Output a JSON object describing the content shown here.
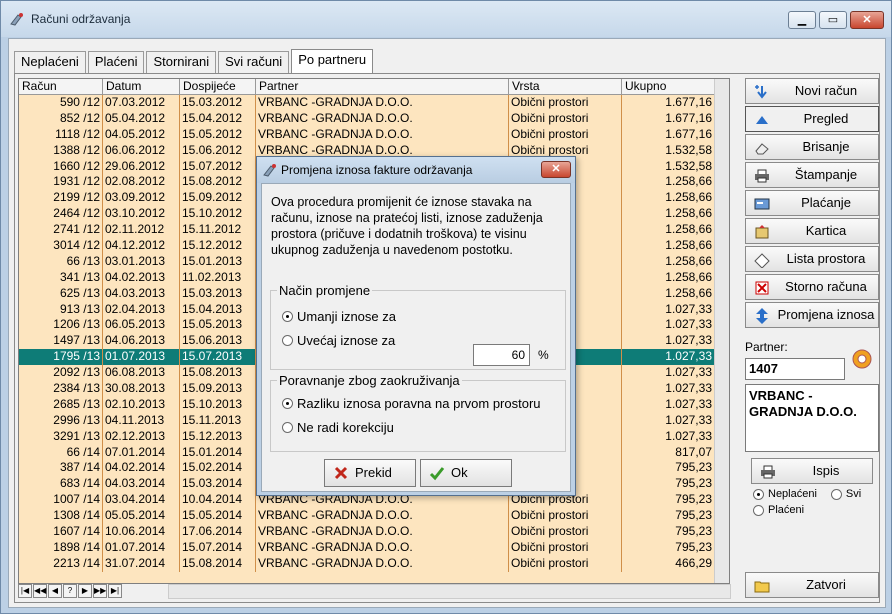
{
  "window": {
    "title": "Računi održavanja"
  },
  "tabs": [
    "Neplaćeni",
    "Plaćeni",
    "Stornirani",
    "Svi računi",
    "Po partneru"
  ],
  "grid": {
    "columns": [
      "Račun",
      "Datum",
      "Dospijeće",
      "Partner",
      "Vrsta",
      "Ukupno"
    ],
    "rows": [
      [
        "590 /12",
        "07.03.2012",
        "15.03.2012",
        "VRBANC -GRADNJA D.O.O.",
        "Obični prostori",
        "1.677,16"
      ],
      [
        "852 /12",
        "05.04.2012",
        "15.04.2012",
        "VRBANC -GRADNJA D.O.O.",
        "Obični prostori",
        "1.677,16"
      ],
      [
        "1118 /12",
        "04.05.2012",
        "15.05.2012",
        "VRBANC -GRADNJA D.O.O.",
        "Obični prostori",
        "1.677,16"
      ],
      [
        "1388 /12",
        "06.06.2012",
        "15.06.2012",
        "VRBANC -GRADNJA D.O.O.",
        "Obični prostori",
        "1.532,58"
      ],
      [
        "1660 /12",
        "29.06.2012",
        "15.07.2012",
        "",
        "prostori",
        "1.532,58"
      ],
      [
        "1931 /12",
        "02.08.2012",
        "15.08.2012",
        "",
        "prostori",
        "1.258,66"
      ],
      [
        "2199 /12",
        "03.09.2012",
        "15.09.2012",
        "",
        "prostori",
        "1.258,66"
      ],
      [
        "2464 /12",
        "03.10.2012",
        "15.10.2012",
        "",
        "prostori",
        "1.258,66"
      ],
      [
        "2741 /12",
        "02.11.2012",
        "15.11.2012",
        "",
        "prostori",
        "1.258,66"
      ],
      [
        "3014 /12",
        "04.12.2012",
        "15.12.2012",
        "",
        "prostori",
        "1.258,66"
      ],
      [
        "66 /13",
        "03.01.2013",
        "15.01.2013",
        "",
        "prostori",
        "1.258,66"
      ],
      [
        "341 /13",
        "04.02.2013",
        "11.02.2013",
        "",
        "prostori",
        "1.258,66"
      ],
      [
        "625 /13",
        "04.03.2013",
        "15.03.2013",
        "",
        "prostori",
        "1.258,66"
      ],
      [
        "913 /13",
        "02.04.2013",
        "15.04.2013",
        "",
        "prostori",
        "1.027,33"
      ],
      [
        "1206 /13",
        "06.05.2013",
        "15.05.2013",
        "",
        "prostori",
        "1.027,33"
      ],
      [
        "1497 /13",
        "04.06.2013",
        "15.06.2013",
        "",
        "prostori",
        "1.027,33"
      ],
      [
        "1795 /13",
        "01.07.2013",
        "15.07.2013",
        "",
        "prostori",
        "1.027,33"
      ],
      [
        "2092 /13",
        "06.08.2013",
        "15.08.2013",
        "",
        "prostori",
        "1.027,33"
      ],
      [
        "2384 /13",
        "30.08.2013",
        "15.09.2013",
        "",
        "prostori",
        "1.027,33"
      ],
      [
        "2685 /13",
        "02.10.2013",
        "15.10.2013",
        "",
        "prostori",
        "1.027,33"
      ],
      [
        "2996 /13",
        "04.11.2013",
        "15.11.2013",
        "",
        "prostori",
        "1.027,33"
      ],
      [
        "3291 /13",
        "02.12.2013",
        "15.12.2013",
        "",
        "prostori",
        "1.027,33"
      ],
      [
        "66 /14",
        "07.01.2014",
        "15.01.2014",
        "",
        "prostori",
        "817,07"
      ],
      [
        "387 /14",
        "04.02.2014",
        "15.02.2014",
        "",
        "prostori",
        "795,23"
      ],
      [
        "683 /14",
        "04.03.2014",
        "15.03.2014",
        "",
        "prostori",
        "795,23"
      ],
      [
        "1007 /14",
        "03.04.2014",
        "10.04.2014",
        "VRBANC -GRADNJA D.O.O.",
        "Obični prostori",
        "795,23"
      ],
      [
        "1308 /14",
        "05.05.2014",
        "15.05.2014",
        "VRBANC -GRADNJA D.O.O.",
        "Obični prostori",
        "795,23"
      ],
      [
        "1607 /14",
        "10.06.2014",
        "17.06.2014",
        "VRBANC -GRADNJA D.O.O.",
        "Obični prostori",
        "795,23"
      ],
      [
        "1898 /14",
        "01.07.2014",
        "15.07.2014",
        "VRBANC -GRADNJA D.O.O.",
        "Obični prostori",
        "795,23"
      ],
      [
        "2213 /14",
        "31.07.2014",
        "15.08.2014",
        "VRBANC -GRADNJA D.O.O.",
        "Obični prostori",
        "466,29"
      ]
    ],
    "selected_index": 16
  },
  "nav_buttons": [
    "|◀",
    "◀◀",
    "◀",
    "?",
    "▶",
    "▶▶",
    "▶|"
  ],
  "side": {
    "buttons": [
      "Novi račun",
      "Pregled",
      "Brisanje",
      "Štampanje",
      "Plaćanje",
      "Kartica",
      "Lista prostora",
      "Storno računa",
      "Promjena iznosa"
    ],
    "partner_label": "Partner:",
    "partner_code": "1407",
    "partner_name": "VRBANC - GRADNJA D.O.O.",
    "ispis": "Ispis",
    "filter": {
      "neplaceni": "Neplaćeni",
      "svi": "Svi",
      "placeni": "Plaćeni"
    },
    "zatvori": "Zatvori"
  },
  "dialog": {
    "title": "Promjena iznosa fakture održavanja",
    "text": "Ova procedura promijenit će iznose stavaka na računu, iznose na pratećoj listi, iznose zaduženja prostora (pričuve i dodatnih troškova) te visinu ukupnog zaduženja u navedenom postotku.",
    "group1": {
      "legend": "Način promjene",
      "opt1": "Umanji iznose za",
      "opt2": "Uvećaj iznose za",
      "value": "60",
      "unit": "%"
    },
    "group2": {
      "legend": "Poravnanje zbog zaokruživanja",
      "opt1": "Razliku iznosa poravna na prvom prostoru",
      "opt2": "Ne radi korekciju"
    },
    "cancel": "Prekid",
    "ok": "Ok"
  },
  "colors": {
    "grid_bg": "#fde5bf",
    "selected_row": "#0e7c77",
    "accent_blue": "#2a6fc9"
  }
}
